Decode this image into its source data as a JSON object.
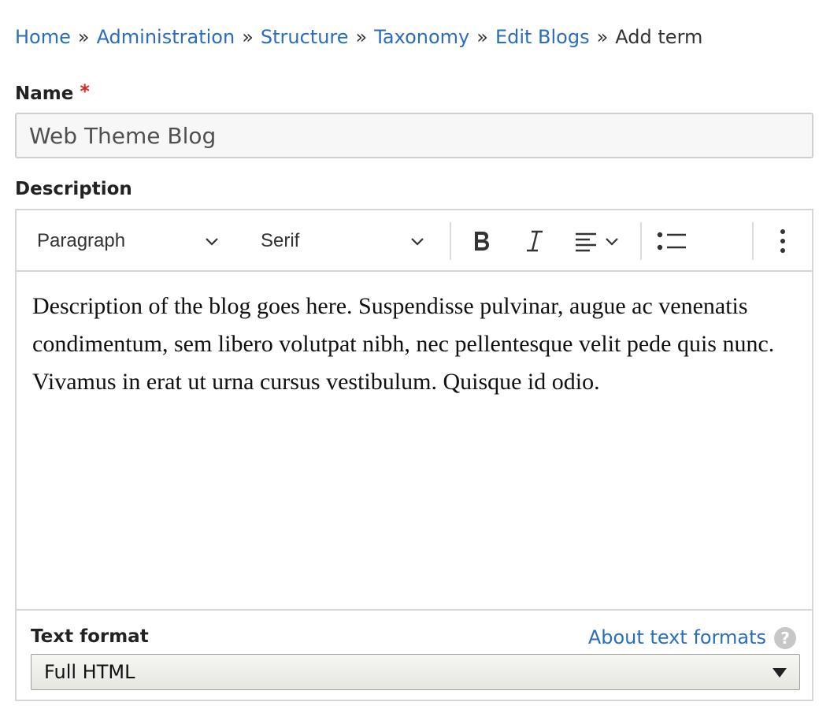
{
  "breadcrumb": {
    "items": [
      "Home",
      "Administration",
      "Structure",
      "Taxonomy",
      "Edit Blogs"
    ],
    "separator": "»",
    "current": "Add term"
  },
  "name_field": {
    "label": "Name",
    "required_mark": "*",
    "value": "Web Theme Blog"
  },
  "description": {
    "label": "Description",
    "toolbar": {
      "heading_select": "Paragraph",
      "font_select": "Serif",
      "icons": [
        "chevron-down-icon",
        "bold-icon",
        "italic-icon",
        "align-left-icon",
        "bulleted-list-icon",
        "more-vertical-icon"
      ]
    },
    "content": "Description of the blog goes here. Suspendisse pulvinar, augue ac venenatis condimentum, sem libero volutpat nibh, nec pellentesque velit pede quis nunc. Vivamus in erat ut urna cursus vestibulum. Quisque id odio."
  },
  "text_format": {
    "label": "Text format",
    "about_link": "About text formats",
    "help_glyph": "?",
    "selected": "Full HTML"
  },
  "colors": {
    "link": "#2a6ebb",
    "required": "#dc2323",
    "border": "#d6d6d6"
  }
}
